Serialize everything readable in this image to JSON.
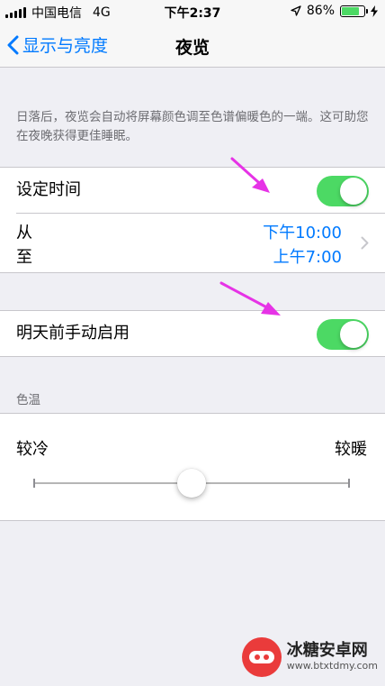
{
  "status_bar": {
    "carrier": "中国电信",
    "network": "4G",
    "time": "下午2:37",
    "battery_percent": "86%",
    "battery_level": 0.86,
    "icons": [
      "signal-icon",
      "location-arrow-icon",
      "battery-icon",
      "charging-bolt-icon"
    ]
  },
  "nav": {
    "back_label": "显示与亮度",
    "title": "夜览"
  },
  "description": "日落后，夜览会自动将屏幕颜色调至色谱偏暖色的一端。这可助您在夜晚获得更佳睡眠。",
  "scheduled": {
    "label": "设定时间",
    "toggle_on": true
  },
  "schedule_times": {
    "from_label": "从",
    "to_label": "至",
    "from_value": "下午10:00",
    "to_value": "上午7:00"
  },
  "manual": {
    "label": "明天前手动启用",
    "toggle_on": true
  },
  "color_temp": {
    "section_header": "色温",
    "less_warm_label": "较冷",
    "more_warm_label": "较暖",
    "slider_value": 0.5
  },
  "watermark": {
    "main": "冰糖安卓网",
    "sub": "www.btxtdmy.com"
  },
  "colors": {
    "accent": "#007aff",
    "toggle_on": "#4cd964",
    "annotation_arrow": "#e633e6"
  }
}
